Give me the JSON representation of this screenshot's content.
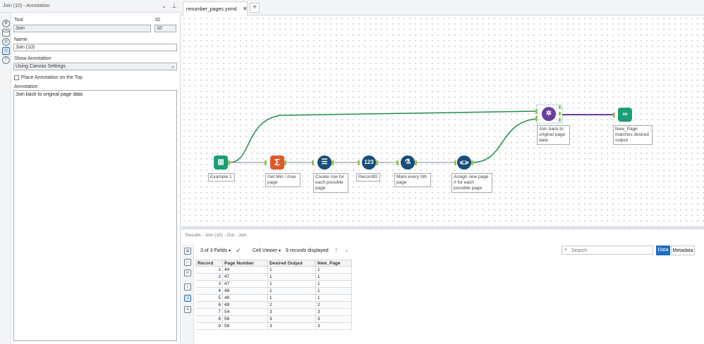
{
  "panel": {
    "title": "Join (10) - Annotation",
    "tool_label": "Tool",
    "tool_value": "Join",
    "id_label": "ID",
    "id_value": "10",
    "name_label": "Name",
    "name_value": "Join (10)",
    "show_annotation_label": "Show Annotation",
    "show_annotation_value": "Using Canvas Settings",
    "place_on_top_label": "Place Annotation on the Top",
    "place_on_top_checked": false,
    "annotation_label": "Annotation",
    "annotation_value": "Join back to original page data"
  },
  "tabs": [
    {
      "label": "renumber_pages.yxmd",
      "active": true
    }
  ],
  "workflow": {
    "tools": [
      {
        "name": "Example 1",
        "color": "#1b9e77",
        "icon": "book-icon"
      },
      {
        "name": "Get Min / max page",
        "color": "#e0592a",
        "icon": "sigma-icon"
      },
      {
        "name": "Create row for each possible page",
        "color": "#164d7a",
        "icon": "generate-rows-icon"
      },
      {
        "name": "RecordID",
        "color": "#164d7a",
        "icon": "record-id-icon"
      },
      {
        "name": "Mark every 5th page",
        "color": "#164d7a",
        "icon": "formula-flask-icon"
      },
      {
        "name": "Assign new page # for each possible page",
        "color": "#164d7a",
        "icon": "multi-row-formula-icon"
      },
      {
        "name": "Join back to original page data",
        "color": "#6a3fa0",
        "icon": "join-icon"
      },
      {
        "name": "New_Page matches desired output",
        "color": "#1b9e77",
        "icon": "browse-binoculars-icon"
      }
    ],
    "connection_color": "#1f8f4c",
    "selected_connection_color": "#6a3fa0"
  },
  "results": {
    "title": "Results - Join (10) - Out - Join",
    "fields_label": "3 of 3 Fields",
    "viewer_label": "Cell Viewer",
    "records_label": "9 records displayed",
    "search_placeholder": "Search",
    "data_button": "Data",
    "metadata_button": "Metadata",
    "columns": [
      "Record",
      "Page Number",
      "Desired Output",
      "New_Page"
    ],
    "rows": [
      [
        "1",
        "44",
        "1",
        "1"
      ],
      [
        "2",
        "47",
        "1",
        "1"
      ],
      [
        "3",
        "47",
        "1",
        "1"
      ],
      [
        "4",
        "48",
        "1",
        "1"
      ],
      [
        "5",
        "48",
        "1",
        "1"
      ],
      [
        "6",
        "49",
        "2",
        "2"
      ],
      [
        "7",
        "54",
        "3",
        "3"
      ],
      [
        "8",
        "58",
        "3",
        "3"
      ],
      [
        "9",
        "58",
        "3",
        "3"
      ]
    ]
  }
}
